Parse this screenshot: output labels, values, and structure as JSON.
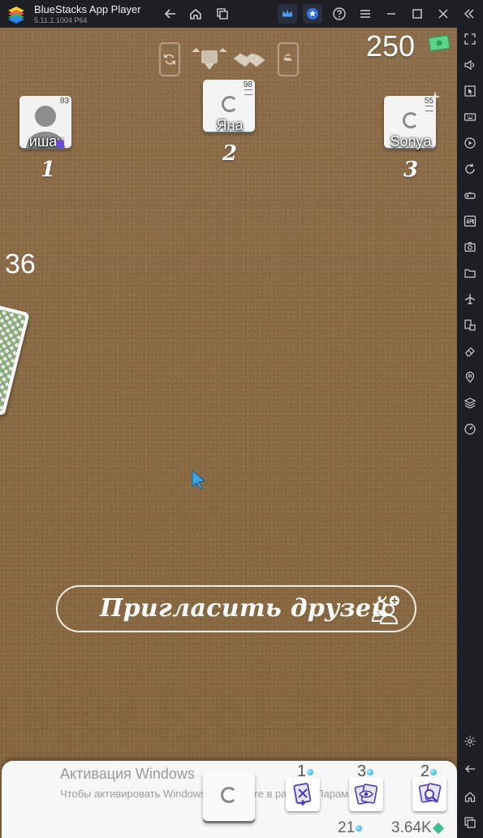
{
  "window": {
    "title": "BlueStacks App Player",
    "version": "5.11.1.1004  P64"
  },
  "titlebar_icons": [
    "back-arrow-icon",
    "home-icon",
    "multi-instance-icon",
    "crown-icon",
    "star-badge-icon",
    "help-icon",
    "menu-icon",
    "minimize-icon",
    "maximize-icon",
    "close-icon",
    "collapse-sidebar-icon"
  ],
  "sidebar_icons": [
    "fullscreen-icon",
    "volume-icon",
    "install-apk-cursor-icon",
    "keyboard-icon",
    "record-icon",
    "rotate-icon",
    "gamepad-icon",
    "apk-icon",
    "screenshot-icon",
    "folder-icon",
    "airplane-icon",
    "resize-icon",
    "eraser-icon",
    "location-icon",
    "layers-icon",
    "speed-icon",
    "settings-icon",
    "back-icon",
    "home-icon",
    "recents-icon"
  ],
  "game": {
    "balance": "250",
    "deck_count": "36",
    "players": [
      {
        "name": "ишак",
        "cards": "83",
        "seat": "1"
      },
      {
        "name": "Яна",
        "cards": "98",
        "seat": "2"
      },
      {
        "name": "Sonya",
        "cards": "55",
        "seat": "3"
      }
    ],
    "invite_label": "Пригласить друзей"
  },
  "bottom": {
    "activation_title": "Активация Windows",
    "activation_subtitle": "Чтобы активировать Windows, перейдите в раздел \"Параметры\".",
    "tools": [
      {
        "count": "1",
        "name": "discard"
      },
      {
        "count": "3",
        "name": "peek"
      },
      {
        "count": "2",
        "name": "search"
      }
    ],
    "cards_stat": "21",
    "coins_stat": "3.64K"
  },
  "colors": {
    "table_felt": "#8d6c48",
    "chrome": "#1e1f24",
    "accent_blue": "#1aa0d8"
  }
}
